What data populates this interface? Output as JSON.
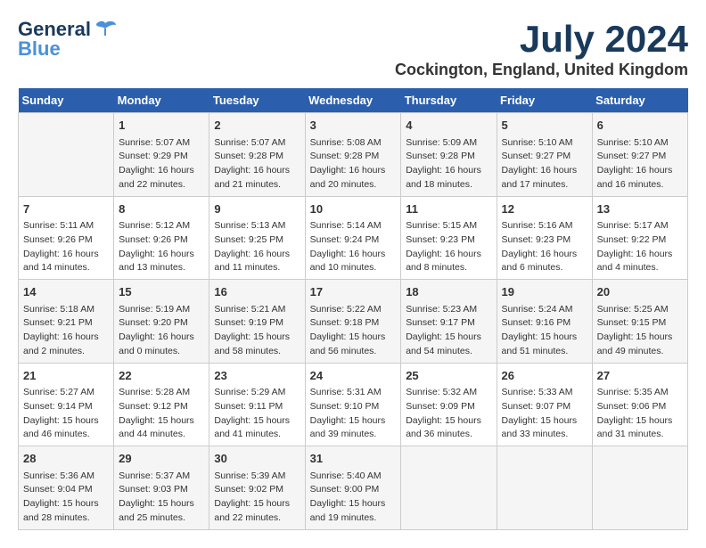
{
  "logo": {
    "line1": "General",
    "line2": "Blue"
  },
  "title": "July 2024",
  "location": "Cockington, England, United Kingdom",
  "days_header": [
    "Sunday",
    "Monday",
    "Tuesday",
    "Wednesday",
    "Thursday",
    "Friday",
    "Saturday"
  ],
  "weeks": [
    [
      {
        "day": "",
        "info": ""
      },
      {
        "day": "1",
        "info": "Sunrise: 5:07 AM\nSunset: 9:29 PM\nDaylight: 16 hours\nand 22 minutes."
      },
      {
        "day": "2",
        "info": "Sunrise: 5:07 AM\nSunset: 9:28 PM\nDaylight: 16 hours\nand 21 minutes."
      },
      {
        "day": "3",
        "info": "Sunrise: 5:08 AM\nSunset: 9:28 PM\nDaylight: 16 hours\nand 20 minutes."
      },
      {
        "day": "4",
        "info": "Sunrise: 5:09 AM\nSunset: 9:28 PM\nDaylight: 16 hours\nand 18 minutes."
      },
      {
        "day": "5",
        "info": "Sunrise: 5:10 AM\nSunset: 9:27 PM\nDaylight: 16 hours\nand 17 minutes."
      },
      {
        "day": "6",
        "info": "Sunrise: 5:10 AM\nSunset: 9:27 PM\nDaylight: 16 hours\nand 16 minutes."
      }
    ],
    [
      {
        "day": "7",
        "info": "Sunrise: 5:11 AM\nSunset: 9:26 PM\nDaylight: 16 hours\nand 14 minutes."
      },
      {
        "day": "8",
        "info": "Sunrise: 5:12 AM\nSunset: 9:26 PM\nDaylight: 16 hours\nand 13 minutes."
      },
      {
        "day": "9",
        "info": "Sunrise: 5:13 AM\nSunset: 9:25 PM\nDaylight: 16 hours\nand 11 minutes."
      },
      {
        "day": "10",
        "info": "Sunrise: 5:14 AM\nSunset: 9:24 PM\nDaylight: 16 hours\nand 10 minutes."
      },
      {
        "day": "11",
        "info": "Sunrise: 5:15 AM\nSunset: 9:23 PM\nDaylight: 16 hours\nand 8 minutes."
      },
      {
        "day": "12",
        "info": "Sunrise: 5:16 AM\nSunset: 9:23 PM\nDaylight: 16 hours\nand 6 minutes."
      },
      {
        "day": "13",
        "info": "Sunrise: 5:17 AM\nSunset: 9:22 PM\nDaylight: 16 hours\nand 4 minutes."
      }
    ],
    [
      {
        "day": "14",
        "info": "Sunrise: 5:18 AM\nSunset: 9:21 PM\nDaylight: 16 hours\nand 2 minutes."
      },
      {
        "day": "15",
        "info": "Sunrise: 5:19 AM\nSunset: 9:20 PM\nDaylight: 16 hours\nand 0 minutes."
      },
      {
        "day": "16",
        "info": "Sunrise: 5:21 AM\nSunset: 9:19 PM\nDaylight: 15 hours\nand 58 minutes."
      },
      {
        "day": "17",
        "info": "Sunrise: 5:22 AM\nSunset: 9:18 PM\nDaylight: 15 hours\nand 56 minutes."
      },
      {
        "day": "18",
        "info": "Sunrise: 5:23 AM\nSunset: 9:17 PM\nDaylight: 15 hours\nand 54 minutes."
      },
      {
        "day": "19",
        "info": "Sunrise: 5:24 AM\nSunset: 9:16 PM\nDaylight: 15 hours\nand 51 minutes."
      },
      {
        "day": "20",
        "info": "Sunrise: 5:25 AM\nSunset: 9:15 PM\nDaylight: 15 hours\nand 49 minutes."
      }
    ],
    [
      {
        "day": "21",
        "info": "Sunrise: 5:27 AM\nSunset: 9:14 PM\nDaylight: 15 hours\nand 46 minutes."
      },
      {
        "day": "22",
        "info": "Sunrise: 5:28 AM\nSunset: 9:12 PM\nDaylight: 15 hours\nand 44 minutes."
      },
      {
        "day": "23",
        "info": "Sunrise: 5:29 AM\nSunset: 9:11 PM\nDaylight: 15 hours\nand 41 minutes."
      },
      {
        "day": "24",
        "info": "Sunrise: 5:31 AM\nSunset: 9:10 PM\nDaylight: 15 hours\nand 39 minutes."
      },
      {
        "day": "25",
        "info": "Sunrise: 5:32 AM\nSunset: 9:09 PM\nDaylight: 15 hours\nand 36 minutes."
      },
      {
        "day": "26",
        "info": "Sunrise: 5:33 AM\nSunset: 9:07 PM\nDaylight: 15 hours\nand 33 minutes."
      },
      {
        "day": "27",
        "info": "Sunrise: 5:35 AM\nSunset: 9:06 PM\nDaylight: 15 hours\nand 31 minutes."
      }
    ],
    [
      {
        "day": "28",
        "info": "Sunrise: 5:36 AM\nSunset: 9:04 PM\nDaylight: 15 hours\nand 28 minutes."
      },
      {
        "day": "29",
        "info": "Sunrise: 5:37 AM\nSunset: 9:03 PM\nDaylight: 15 hours\nand 25 minutes."
      },
      {
        "day": "30",
        "info": "Sunrise: 5:39 AM\nSunset: 9:02 PM\nDaylight: 15 hours\nand 22 minutes."
      },
      {
        "day": "31",
        "info": "Sunrise: 5:40 AM\nSunset: 9:00 PM\nDaylight: 15 hours\nand 19 minutes."
      },
      {
        "day": "",
        "info": ""
      },
      {
        "day": "",
        "info": ""
      },
      {
        "day": "",
        "info": ""
      }
    ]
  ]
}
